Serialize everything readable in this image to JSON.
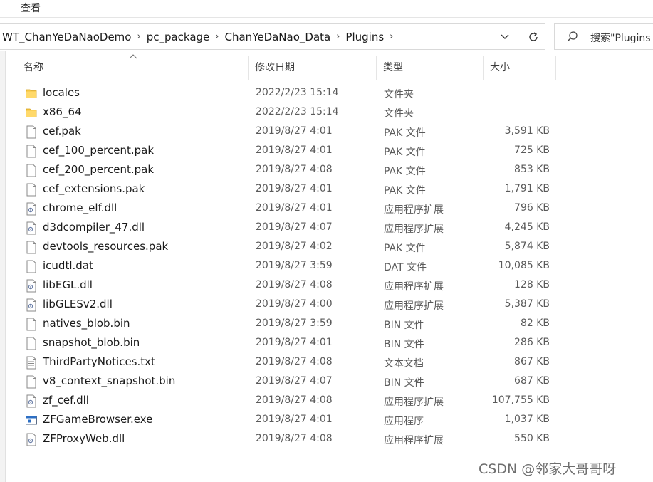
{
  "menu": {
    "view": "查看"
  },
  "breadcrumb": [
    "WT_ChanYeDaNaoDemo",
    "pc_package",
    "ChanYeDaNao_Data",
    "Plugins"
  ],
  "search": {
    "placeholder": "搜索\"Plugins"
  },
  "columns": {
    "name": "名称",
    "date": "修改日期",
    "type": "类型",
    "size": "大小"
  },
  "files": [
    {
      "name": "locales",
      "date": "2022/2/23 15:14",
      "type": "文件夹",
      "size": "",
      "icon": "folder-icon"
    },
    {
      "name": "x86_64",
      "date": "2022/2/23 15:14",
      "type": "文件夹",
      "size": "",
      "icon": "folder-icon"
    },
    {
      "name": "cef.pak",
      "date": "2019/8/27 4:01",
      "type": "PAK 文件",
      "size": "3,591 KB",
      "icon": "file-icon"
    },
    {
      "name": "cef_100_percent.pak",
      "date": "2019/8/27 4:01",
      "type": "PAK 文件",
      "size": "725 KB",
      "icon": "file-icon"
    },
    {
      "name": "cef_200_percent.pak",
      "date": "2019/8/27 4:08",
      "type": "PAK 文件",
      "size": "853 KB",
      "icon": "file-icon"
    },
    {
      "name": "cef_extensions.pak",
      "date": "2019/8/27 4:01",
      "type": "PAK 文件",
      "size": "1,791 KB",
      "icon": "file-icon"
    },
    {
      "name": "chrome_elf.dll",
      "date": "2019/8/27 4:01",
      "type": "应用程序扩展",
      "size": "796 KB",
      "icon": "dll-icon"
    },
    {
      "name": "d3dcompiler_47.dll",
      "date": "2019/8/27 4:07",
      "type": "应用程序扩展",
      "size": "4,245 KB",
      "icon": "dll-icon"
    },
    {
      "name": "devtools_resources.pak",
      "date": "2019/8/27 4:02",
      "type": "PAK 文件",
      "size": "5,874 KB",
      "icon": "file-icon"
    },
    {
      "name": "icudtl.dat",
      "date": "2019/8/27 3:59",
      "type": "DAT 文件",
      "size": "10,085 KB",
      "icon": "file-icon"
    },
    {
      "name": "libEGL.dll",
      "date": "2019/8/27 4:08",
      "type": "应用程序扩展",
      "size": "128 KB",
      "icon": "dll-icon"
    },
    {
      "name": "libGLESv2.dll",
      "date": "2019/8/27 4:00",
      "type": "应用程序扩展",
      "size": "5,387 KB",
      "icon": "dll-icon"
    },
    {
      "name": "natives_blob.bin",
      "date": "2019/8/27 3:59",
      "type": "BIN 文件",
      "size": "82 KB",
      "icon": "file-icon"
    },
    {
      "name": "snapshot_blob.bin",
      "date": "2019/8/27 4:01",
      "type": "BIN 文件",
      "size": "286 KB",
      "icon": "file-icon"
    },
    {
      "name": "ThirdPartyNotices.txt",
      "date": "2019/8/27 4:08",
      "type": "文本文档",
      "size": "867 KB",
      "icon": "text-file-icon"
    },
    {
      "name": "v8_context_snapshot.bin",
      "date": "2019/8/27 4:07",
      "type": "BIN 文件",
      "size": "687 KB",
      "icon": "file-icon"
    },
    {
      "name": "zf_cef.dll",
      "date": "2019/8/27 4:08",
      "type": "应用程序扩展",
      "size": "107,755 KB",
      "icon": "dll-icon"
    },
    {
      "name": "ZFGameBrowser.exe",
      "date": "2019/8/27 4:01",
      "type": "应用程序",
      "size": "1,037 KB",
      "icon": "exe-icon"
    },
    {
      "name": "ZFProxyWeb.dll",
      "date": "2019/8/27 4:08",
      "type": "应用程序扩展",
      "size": "550 KB",
      "icon": "dll-icon"
    }
  ],
  "watermark": "CSDN @邻家大哥哥呀"
}
